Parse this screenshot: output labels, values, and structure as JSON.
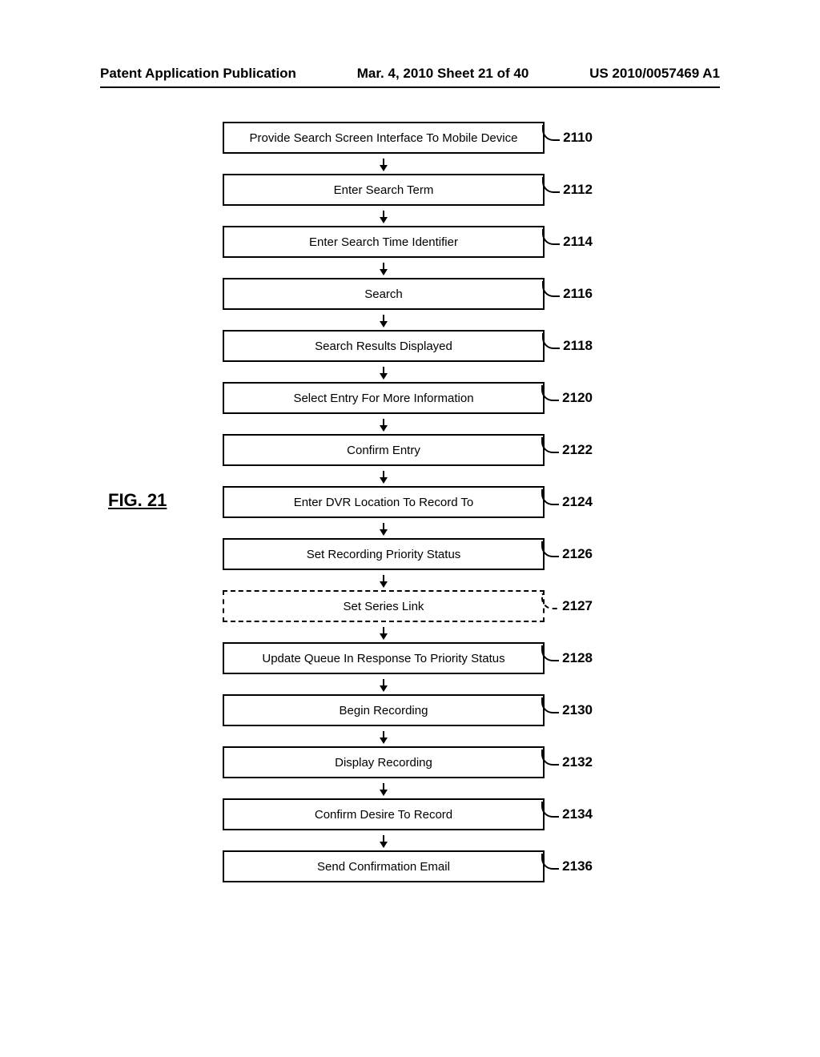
{
  "header": {
    "left": "Patent Application Publication",
    "center": "Mar. 4, 2010  Sheet 21 of 40",
    "right": "US 2010/0057469 A1"
  },
  "figure_label": "FIG. 21",
  "steps": [
    {
      "label": "Provide Search Screen Interface To Mobile Device",
      "ref": "2110",
      "dashed": false
    },
    {
      "label": "Enter Search Term",
      "ref": "2112",
      "dashed": false
    },
    {
      "label": "Enter Search Time Identifier",
      "ref": "2114",
      "dashed": false
    },
    {
      "label": "Search",
      "ref": "2116",
      "dashed": false
    },
    {
      "label": "Search Results Displayed",
      "ref": "2118",
      "dashed": false
    },
    {
      "label": "Select Entry For More Information",
      "ref": "2120",
      "dashed": false
    },
    {
      "label": "Confirm Entry",
      "ref": "2122",
      "dashed": false
    },
    {
      "label": "Enter DVR Location To Record To",
      "ref": "2124",
      "dashed": false
    },
    {
      "label": "Set Recording Priority Status",
      "ref": "2126",
      "dashed": false
    },
    {
      "label": "Set Series Link",
      "ref": "2127",
      "dashed": true
    },
    {
      "label": "Update Queue In Response To Priority Status",
      "ref": "2128",
      "dashed": false
    },
    {
      "label": "Begin Recording",
      "ref": "2130",
      "dashed": false
    },
    {
      "label": "Display Recording",
      "ref": "2132",
      "dashed": false
    },
    {
      "label": "Confirm Desire To Record",
      "ref": "2134",
      "dashed": false
    },
    {
      "label": "Send Confirmation Email",
      "ref": "2136",
      "dashed": false
    }
  ]
}
